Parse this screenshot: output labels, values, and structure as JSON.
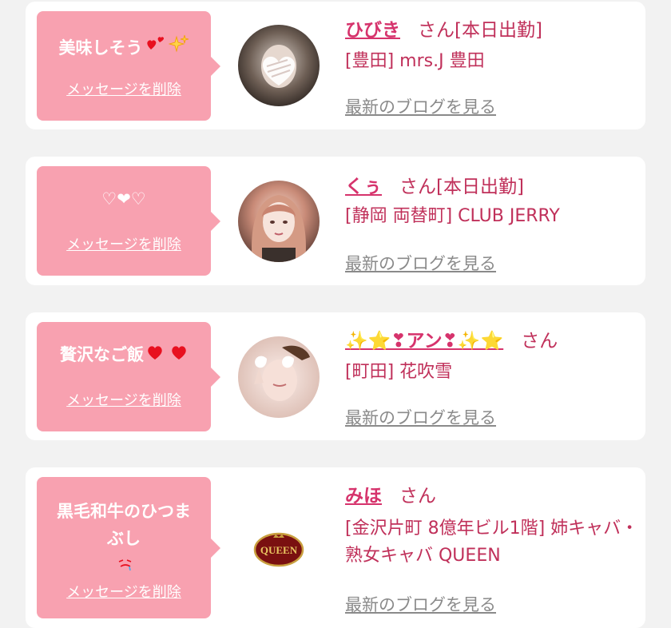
{
  "colors": {
    "background": "#f2f2f2",
    "card": "#ffffff",
    "bubble": "#f8a1b0",
    "name": "#d6336c",
    "text": "#c0305a",
    "blog_link": "#8a8a8a"
  },
  "cards": [
    {
      "message": "美味しそう",
      "message_icons": [
        "two-hearts-icon",
        "sparkles-icon"
      ],
      "delete_label": "メッセージを削除",
      "avatar": "blurred-heart-face-avatar",
      "name": "ひびき",
      "suffix": "さん[本日出勤]",
      "shop": "[豊田] mrs.J 豊田",
      "blog_label": "最新のブログを見る"
    },
    {
      "message": "♡❤♡",
      "message_icons": [],
      "delete_label": "メッセージを削除",
      "avatar": "pink-hair-girl-avatar",
      "name": "くぅ",
      "suffix": "さん[本日出勤]",
      "shop": "[静岡 両替町] CLUB JERRY",
      "blog_label": "最新のブログを見る"
    },
    {
      "message": "贅沢なご飯",
      "message_icons": [
        "heart-icon",
        "heart-icon"
      ],
      "delete_label": "メッセージを削除",
      "avatar": "peace-sign-girl-avatar",
      "name": "✨⭐❣アン❣✨⭐",
      "suffix": "さん",
      "shop": "[町田] 花吹雪",
      "blog_label": "最新のブログを見る"
    },
    {
      "message": "黒毛和牛のひつまぶし",
      "message_icons": [
        "drooling-face-icon"
      ],
      "delete_label": "メッセージを削除",
      "avatar": "queen-logo-avatar",
      "name": "みほ",
      "suffix": "さん",
      "shop": "[金沢片町 8億年ビル1階] 姉キャバ・熟女キャバ QUEEN",
      "blog_label": "最新のブログを見る"
    }
  ]
}
